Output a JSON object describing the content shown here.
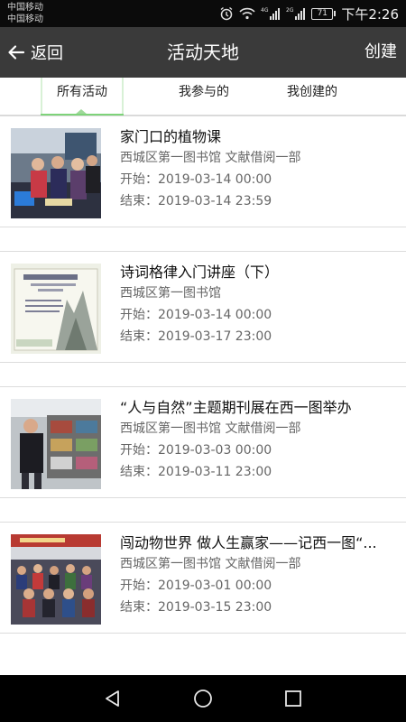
{
  "status_bar": {
    "carrier_1": "中国移动",
    "carrier_2": "中国移动",
    "network_1": "4G",
    "network_2": "2G",
    "battery": "71",
    "time": "下午2:26",
    "icons": [
      "alarm-icon",
      "wifi-icon",
      "signal-icon",
      "signal-icon",
      "battery-icon"
    ]
  },
  "header": {
    "back_label": "返回",
    "title": "活动天地",
    "create_label": "创建"
  },
  "tabs": [
    {
      "label": "所有活动",
      "selected": true
    },
    {
      "label": "我参与的",
      "selected": false
    },
    {
      "label": "我创建的",
      "selected": false
    }
  ],
  "colors": {
    "appbar": "#3a3a3a",
    "tab_indicator": "#7ed37a"
  },
  "activities": [
    {
      "title": "家门口的植物课",
      "location": "西城区第一图书馆 文献借阅一部",
      "start": "开始：2019-03-14 00:00",
      "end": "结束：2019-03-14 23:59"
    },
    {
      "title": "诗词格律入门讲座（下）",
      "location": "西城区第一图书馆",
      "start": "开始：2019-03-14 00:00",
      "end": "结束：2019-03-17 23:00"
    },
    {
      "title": "“人与自然”主题期刊展在西一图举办",
      "location": "西城区第一图书馆 文献借阅一部",
      "start": "开始：2019-03-03 00:00",
      "end": "结束：2019-03-11 23:00"
    },
    {
      "title": "闯动物世界 做人生赢家——记西一图“...",
      "location": "西城区第一图书馆 文献借阅一部",
      "start": "开始：2019-03-01 00:00",
      "end": "结束：2019-03-15 23:00"
    }
  ],
  "nav": {
    "icons": [
      "back-triangle-icon",
      "home-circle-icon",
      "recents-square-icon"
    ]
  }
}
